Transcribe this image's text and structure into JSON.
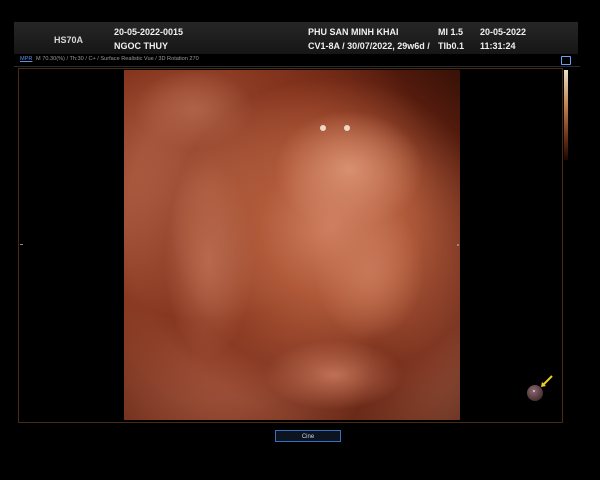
{
  "header": {
    "model": "HS70A",
    "patient_id": "20-05-2022-0015",
    "patient_name": "NGOC THUY",
    "hospital": "PHU SAN MINH KHAI",
    "exam_info": "CV1-8A / 30/07/2022, 29w6d /",
    "mi": "MI  1.5",
    "tib": "TIb0.1",
    "date": "20-05-2022",
    "time": "11:31:24"
  },
  "info_bar": {
    "mode_tag": "MPR",
    "params": "M 70.30(%) / Th:30 / C+ / Surface Realistic Vue / 3D Rotation 270"
  },
  "controls": {
    "cine_label": "Cine"
  },
  "colors": {
    "accent_blue": "#3a70c0",
    "render_tint": "#b05a3a",
    "arrow": "#f0d020"
  },
  "icons": {
    "orientation_marker": "sphere-icon",
    "pointer": "arrow-icon",
    "side_box": "box-icon"
  }
}
